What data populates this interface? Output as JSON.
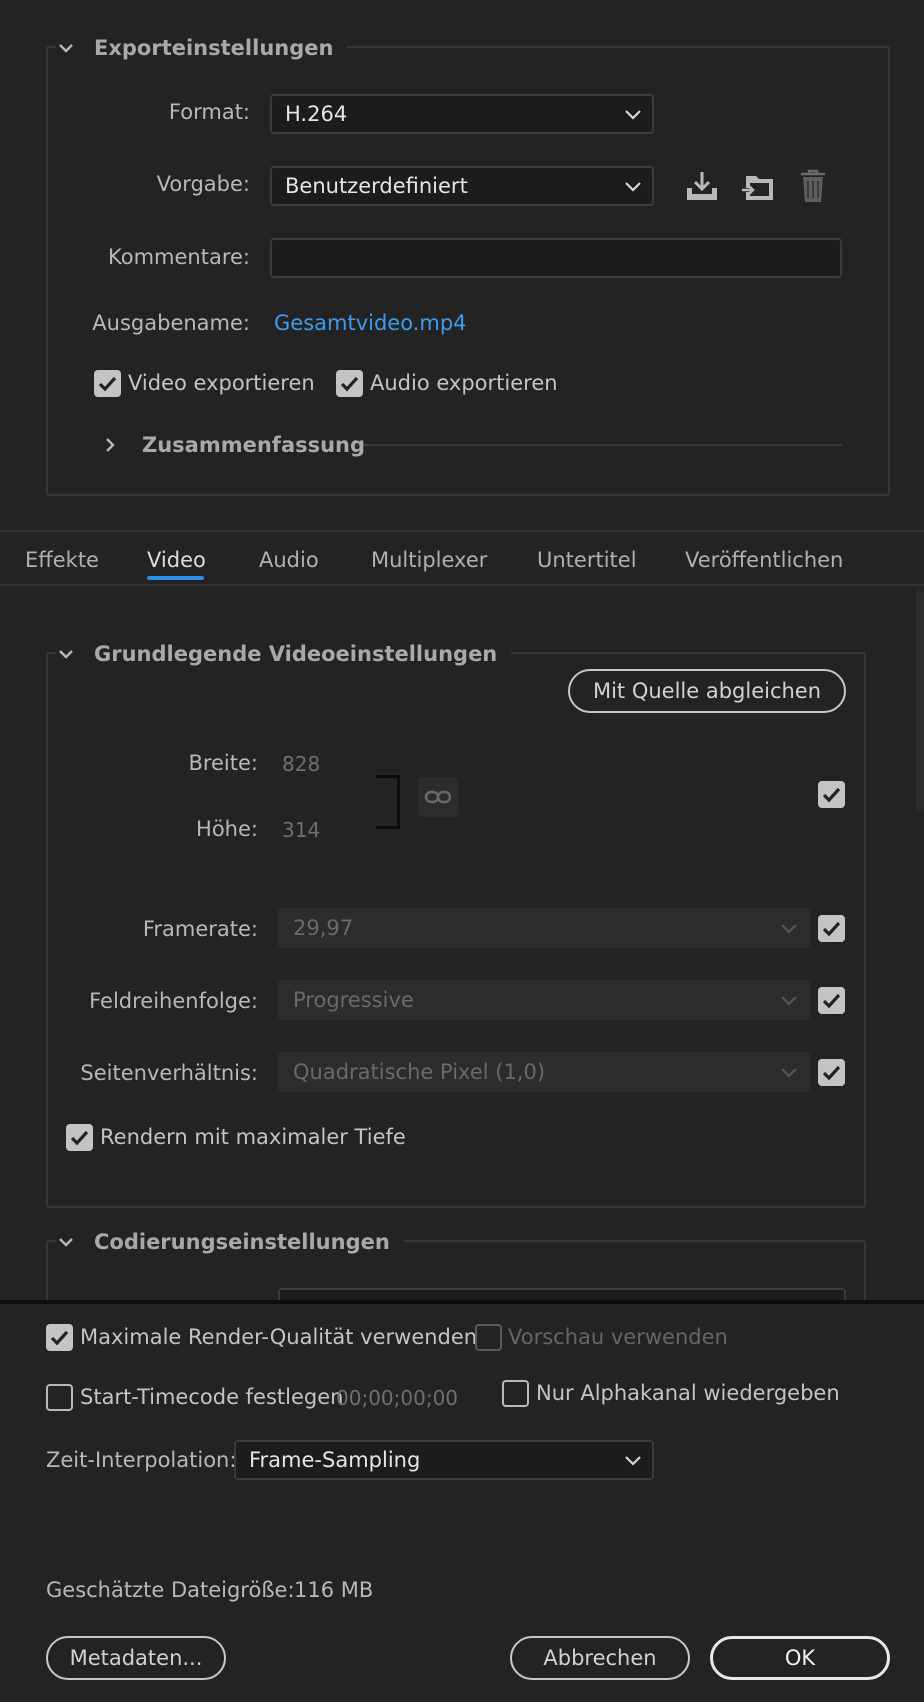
{
  "export": {
    "section_title": "Exporteinstellungen",
    "format_label": "Format:",
    "format_value": "H.264",
    "preset_label": "Vorgabe:",
    "preset_value": "Benutzerdefiniert",
    "comments_label": "Kommentare:",
    "comments_value": "",
    "output_label": "Ausgabename:",
    "output_value": "Gesamtvideo.mp4",
    "video_export_label": "Video exportieren",
    "video_export_checked": true,
    "audio_export_label": "Audio exportieren",
    "audio_export_checked": true,
    "summary_title": "Zusammenfassung",
    "icons": [
      "save-preset-icon",
      "import-preset-icon",
      "delete-preset-icon"
    ]
  },
  "tabs": [
    {
      "label": "Effekte",
      "active": false
    },
    {
      "label": "Video",
      "active": true
    },
    {
      "label": "Audio",
      "active": false
    },
    {
      "label": "Multiplexer",
      "active": false
    },
    {
      "label": "Untertitel",
      "active": false
    },
    {
      "label": "Veröffentlichen",
      "active": false
    }
  ],
  "video": {
    "section_title": "Grundlegende Videoeinstellungen",
    "match_source_label": "Mit Quelle abgleichen",
    "width_label": "Breite:",
    "width_value": "828",
    "height_label": "Höhe:",
    "height_value": "314",
    "framerate_label": "Framerate:",
    "framerate_value": "29,97",
    "field_order_label": "Feldreihenfolge:",
    "field_order_value": "Progressive",
    "aspect_label": "Seitenverhältnis:",
    "aspect_value": "Quadratische Pixel (1,0)",
    "max_depth_label": "Rendern mit maximaler Tiefe",
    "max_depth_checked": true
  },
  "encoding": {
    "section_title": "Codierungseinstellungen"
  },
  "bottom": {
    "max_quality_label": "Maximale Render-Qualität verwenden",
    "max_quality_checked": true,
    "preview_label": "Vorschau verwenden",
    "preview_checked": false,
    "timecode_label": "Start-Timecode festlegen",
    "timecode_checked": false,
    "timecode_value": "00;00;00;00",
    "alpha_label": "Nur Alphakanal wiedergeben",
    "alpha_checked": false,
    "time_interp_label": "Zeit-Interpolation:",
    "time_interp_value": "Frame-Sampling",
    "filesize_label": "Geschätzte Dateigröße:",
    "filesize_value": "116 MB",
    "metadata_button": "Metadaten...",
    "cancel_button": "Abbrechen",
    "ok_button": "OK"
  },
  "colors": {
    "background": "#232323",
    "accent": "#2d8ceb",
    "link": "#3d9cf0"
  }
}
